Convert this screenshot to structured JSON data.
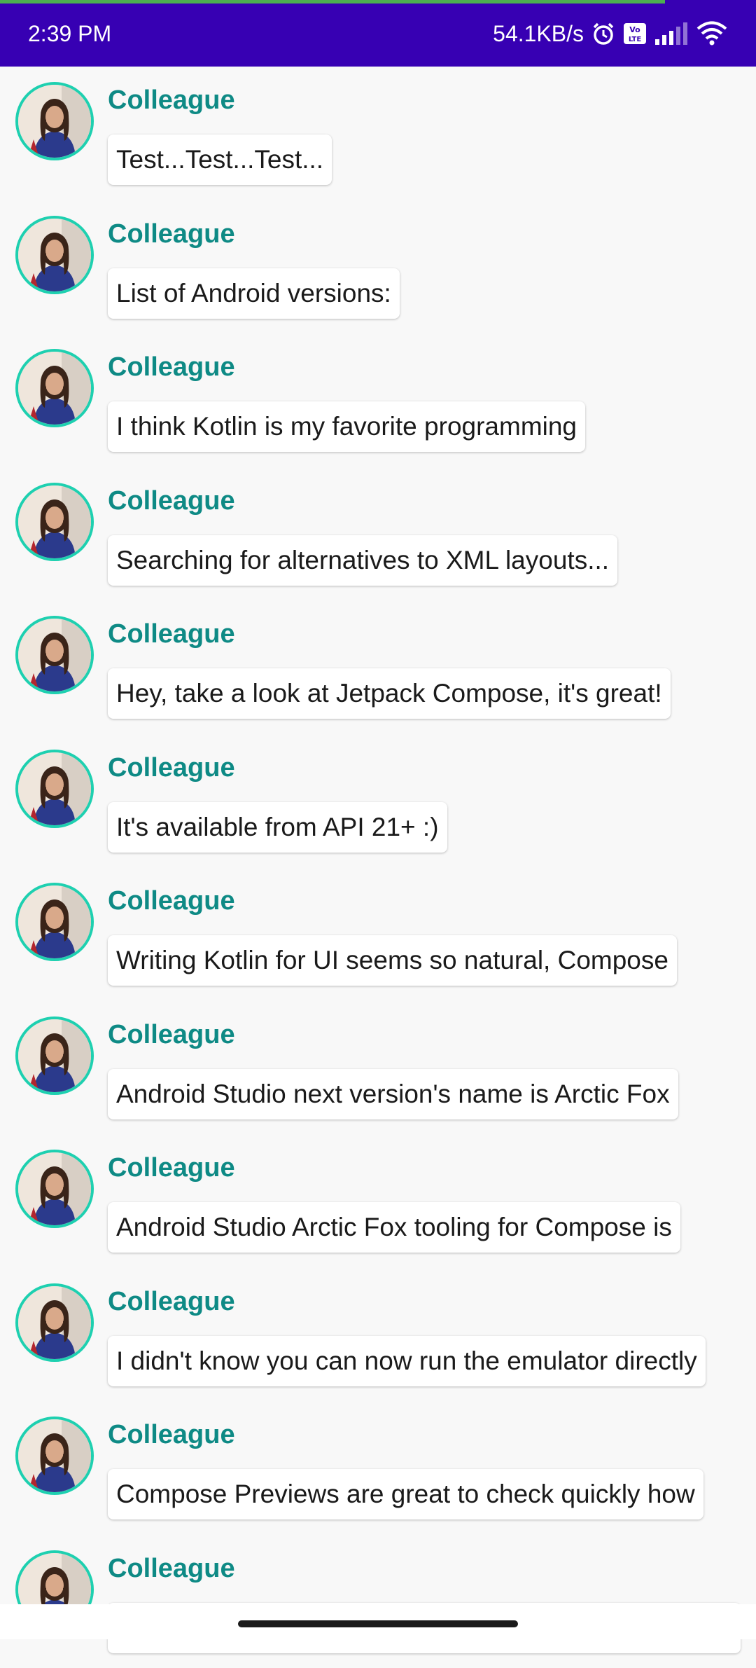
{
  "status_bar": {
    "time": "2:39 PM",
    "network_speed": "54.1KB/s",
    "icons": [
      "alarm-icon",
      "volte-icon",
      "signal-icon",
      "wifi-icon"
    ],
    "background_color": "#3700b3",
    "progress_line_color": "#4caf50"
  },
  "messages": [
    {
      "author": "Colleague",
      "body": "Test...Test...Test..."
    },
    {
      "author": "Colleague",
      "body": "List of Android versions:"
    },
    {
      "author": "Colleague",
      "body": "I think Kotlin is my favorite programming"
    },
    {
      "author": "Colleague",
      "body": "Searching for alternatives to XML layouts..."
    },
    {
      "author": "Colleague",
      "body": "Hey, take a look at Jetpack Compose, it's great!"
    },
    {
      "author": "Colleague",
      "body": "It's available from API 21+ :)"
    },
    {
      "author": "Colleague",
      "body": "Writing Kotlin for UI seems so natural, Compose"
    },
    {
      "author": "Colleague",
      "body": "Android Studio next version's name is Arctic Fox"
    },
    {
      "author": "Colleague",
      "body": "Android Studio Arctic Fox tooling for Compose is"
    },
    {
      "author": "Colleague",
      "body": "I didn't know you can now run the emulator directly"
    },
    {
      "author": "Colleague",
      "body": "Compose Previews are great to check quickly how"
    },
    {
      "author": "Colleague",
      "body": ""
    }
  ],
  "colors": {
    "author_name": "#0e8a85",
    "avatar_border": "#1ed0b0",
    "background": "#f8f8f8"
  }
}
